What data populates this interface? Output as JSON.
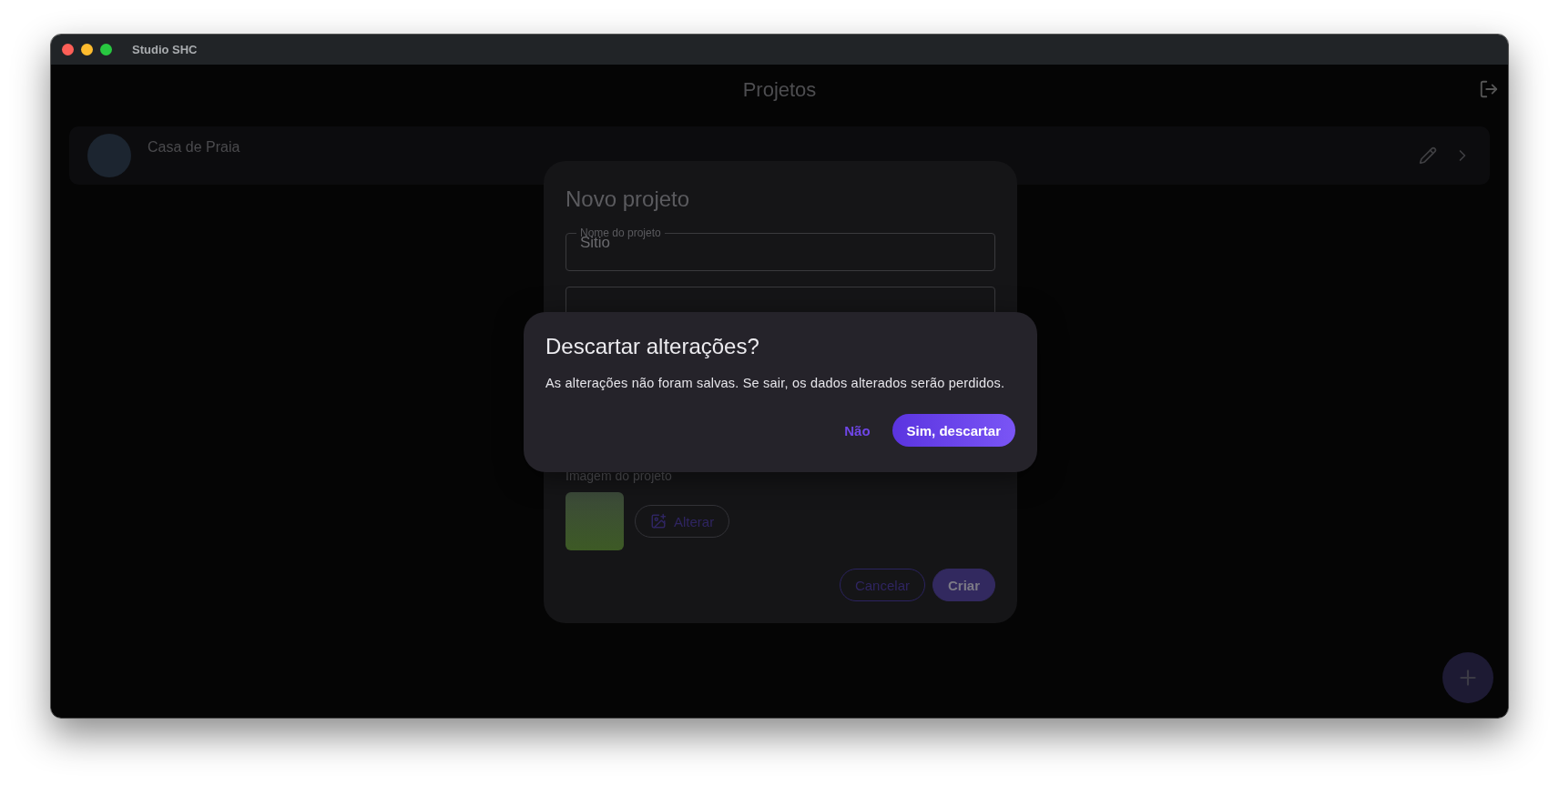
{
  "window": {
    "title": "Studio SHC"
  },
  "header": {
    "title": "Projetos"
  },
  "projects": [
    {
      "name": "Casa de Praia"
    }
  ],
  "project_form": {
    "title": "Novo projeto",
    "name_field": {
      "label": "Nome do projeto",
      "value": "Sitio"
    },
    "image_label": "Imagem do projeto",
    "change_image_button": "Alterar",
    "buttons": [
      {
        "label": "Cancelar",
        "kind": "outlined"
      },
      {
        "label": "Criar",
        "kind": "filled"
      }
    ]
  },
  "confirm_dialog": {
    "title": "Descartar alterações?",
    "message": "As alterações não foram salvas. Se sair, os dados alterados serão perdidos.",
    "buttons": [
      {
        "label": "Não",
        "kind": "text"
      },
      {
        "label": "Sim, descartar",
        "kind": "filled"
      }
    ]
  }
}
